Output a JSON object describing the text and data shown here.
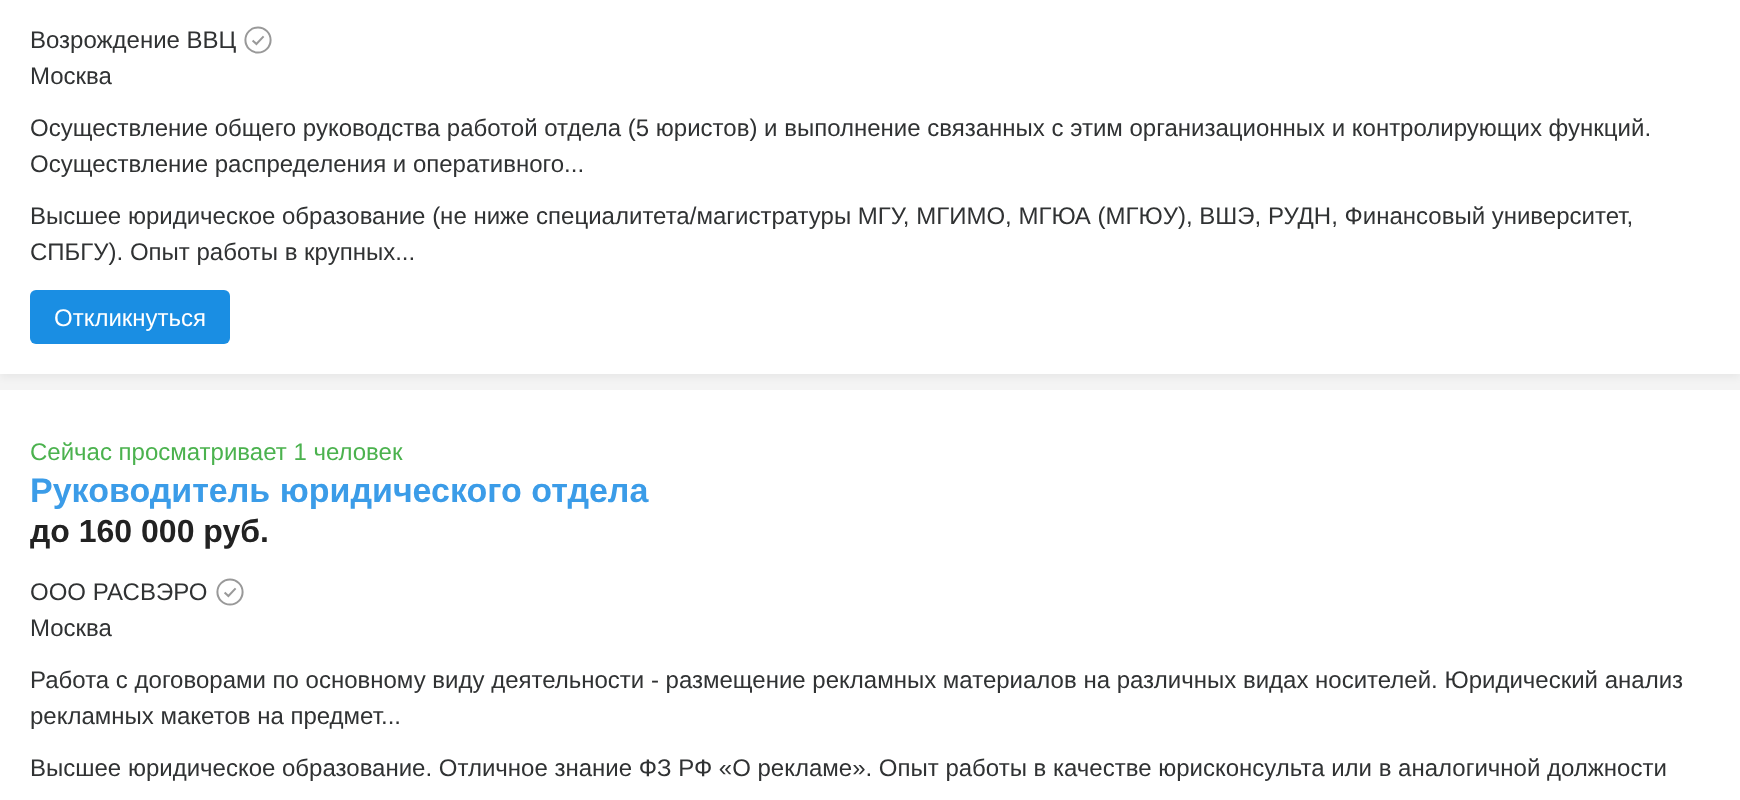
{
  "vacancies": [
    {
      "company": "Возрождение ВВЦ",
      "verified": true,
      "city": "Москва",
      "description": [
        "Осуществление общего руководства работой отдела (5 юристов) и выполнение связанных с этим организационных и контролирующих функций.",
        "Осуществление распределения и оперативного..."
      ],
      "requirements": [
        "Высшее юридическое образование (не ниже специалитета/магистратуры МГУ, МГИМО, МГЮА (МГЮУ), ВШЭ, РУДН, Финансовый университет,",
        "СПБГУ). Опыт работы в крупных..."
      ],
      "button": "Откликнуться"
    },
    {
      "viewers": "Сейчас просматривает 1 человек",
      "title": "Руководитель юридического отдела",
      "salary": "до 160 000 руб.",
      "company": "ООО РАСВЭРО",
      "verified": true,
      "city": "Москва",
      "description": [
        "Работа с договорами по основному виду деятельности - размещение рекламных материалов на различных видах носителей. Юридический анализ",
        "рекламных макетов на предмет..."
      ],
      "requirements": [
        "Высшее юридическое образование. Отличное знание ФЗ РФ «О рекламе». Опыт работы в качестве юрисконсульта или в аналогичной должности"
      ]
    }
  ]
}
